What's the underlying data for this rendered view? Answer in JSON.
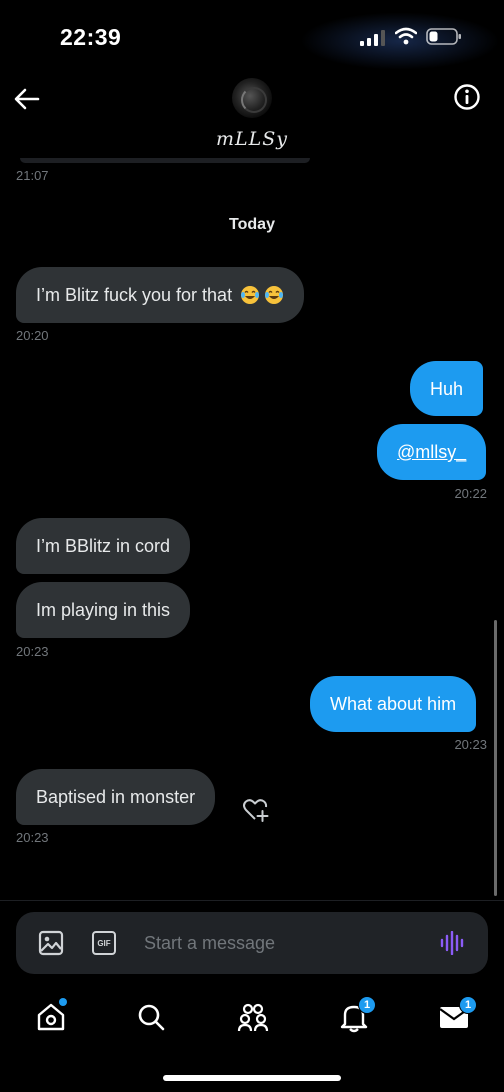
{
  "status_bar": {
    "time": "22:39"
  },
  "header": {
    "contact_name": "mLLSy"
  },
  "conversation": {
    "previous_time": "21:07",
    "date_divider": "Today",
    "messages": [
      {
        "direction": "received",
        "text": "I’m Blitz fuck you for that",
        "emoji": [
          "face-with-tears-of-joy",
          "face-with-tears-of-joy"
        ]
      },
      {
        "direction": "sent",
        "text": "Huh"
      },
      {
        "direction": "sent",
        "text": "@mllsy_"
      },
      {
        "direction": "received",
        "text": "I’m BBlitz in cord"
      },
      {
        "direction": "received",
        "text": "Im playing in this"
      },
      {
        "direction": "sent",
        "text": "What about him"
      },
      {
        "direction": "received",
        "text": "Baptised in monster"
      }
    ],
    "timestamps": [
      "20:20",
      "20:22",
      "20:23",
      "20:23",
      "20:23"
    ]
  },
  "composer": {
    "placeholder": "Start a message",
    "gif_label": "GIF"
  },
  "bottom_nav": {
    "items": [
      "home",
      "search",
      "communities",
      "notifications",
      "messages"
    ],
    "notifications_badge": "1",
    "messages_badge": "1"
  },
  "colors": {
    "accent": "#1d9bf0",
    "received_bubble": "#2f3336",
    "background": "#000000",
    "muted_text": "#71767b"
  }
}
